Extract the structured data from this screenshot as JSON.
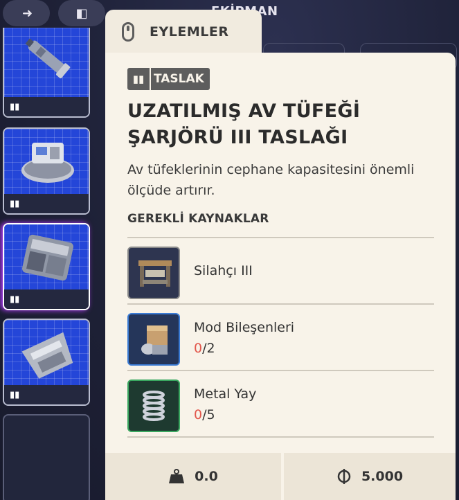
{
  "header": {
    "title": "EKİPMAN",
    "top_buttons": [
      {
        "icon": "collapse-arrows-icon",
        "glyph": "→←"
      },
      {
        "icon": "dock-left-icon",
        "glyph": "▮←"
      }
    ]
  },
  "inventory": {
    "slots": [
      {
        "item_icon": "flashlight-item",
        "blueprint_icon": "book-icon",
        "selected": false
      },
      {
        "item_icon": "turret-item",
        "blueprint_icon": "book-icon",
        "selected": false
      },
      {
        "item_icon": "magazine-item",
        "blueprint_icon": "book-icon",
        "selected": true
      },
      {
        "item_icon": "armor-item",
        "blueprint_icon": "book-icon",
        "selected": false
      },
      {
        "item_icon": "",
        "blueprint_icon": "",
        "selected": false
      }
    ]
  },
  "actions_tab": {
    "label": "EYLEMLER",
    "icon": "mouse-icon"
  },
  "tooltip": {
    "tag": {
      "icon": "book-icon",
      "label": "TASLAK"
    },
    "title": "UZATILMIŞ AV TÜFEĞİ ŞARJÖRÜ III TASLAĞI",
    "description": "Av tüfeklerinin cephane kapasitesini önemli ölçüde artırır.",
    "requirements_heading": "GEREKLİ KAYNAKLAR",
    "requirements": [
      {
        "name": "Silahçı III",
        "have": "",
        "need": "",
        "thumb_color": "#2e3550",
        "border_color": "#8a8a8a"
      },
      {
        "name": "Mod Bileşenleri",
        "have": "0",
        "need": "/2",
        "thumb_color": "#25365a",
        "border_color": "#3a7bd5"
      },
      {
        "name": "Metal Yay",
        "have": "0",
        "need": "/5",
        "thumb_color": "#1e3a30",
        "border_color": "#3aa860"
      }
    ],
    "footer": {
      "weight_icon": "weight-icon",
      "weight": "0.0",
      "price_icon": "coin-icon",
      "price": "5.000"
    }
  },
  "colors": {
    "accent_missing": "#e2574c",
    "tooltip_bg": "#f8f3e9",
    "slot_blue": "#2446d8"
  }
}
